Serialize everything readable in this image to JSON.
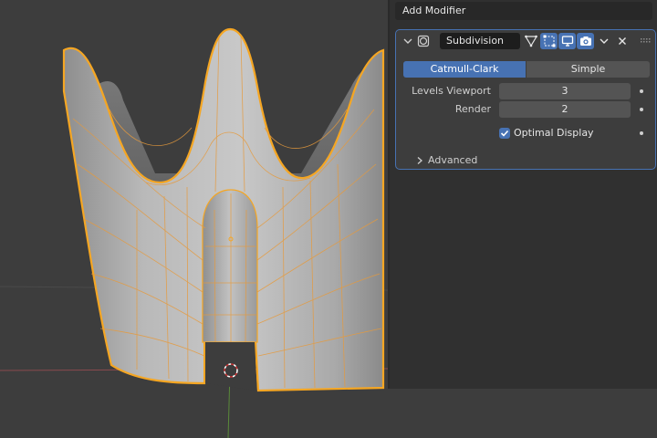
{
  "properties_panel": {
    "add_modifier_label": "Add Modifier",
    "modifier": {
      "name": "Subdivision",
      "type_icon": "subdivision-modifier-icon",
      "toggle_icons": [
        "edit-mode-cage-icon",
        "edit-mode-icon",
        "viewport-display-icon",
        "render-camera-icon"
      ],
      "algorithm": {
        "options": [
          "Catmull-Clark",
          "Simple"
        ],
        "selected": "Catmull-Clark"
      },
      "levels_viewport": {
        "label": "Levels Viewport",
        "value": "3"
      },
      "render": {
        "label": "Render",
        "value": "2"
      },
      "optimal_display": {
        "label": "Optimal Display",
        "checked": true
      },
      "advanced_label": "Advanced"
    }
  },
  "colors": {
    "accent_blue": "#4772b3",
    "selection_orange": "#f5a623",
    "panel_bg": "#303030",
    "viewport_bg": "#3d3d3d"
  }
}
